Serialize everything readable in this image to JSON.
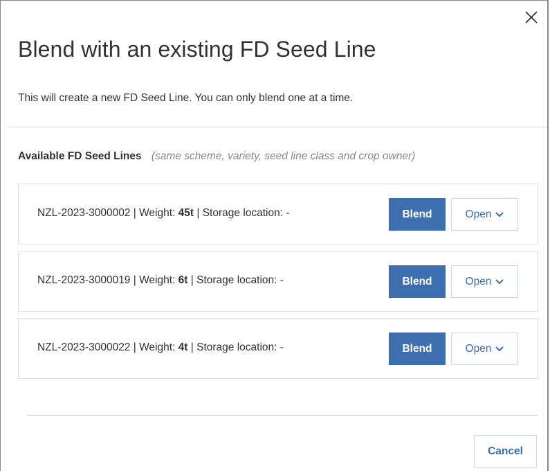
{
  "dialog": {
    "title": "Blend with an existing FD Seed Line",
    "subtitle": "This will create a new FD Seed Line. You can only blend one at a time.",
    "close_icon": "close-icon"
  },
  "section": {
    "label": "Available FD Seed Lines",
    "hint": "(same scheme, variety, seed line class and crop owner)"
  },
  "seed_lines": [
    {
      "id": "NZL-2023-3000002",
      "weight_label": "Weight:",
      "weight": "45t",
      "location_label": "Storage location:",
      "location": "-",
      "blend_label": "Blend",
      "open_label": "Open"
    },
    {
      "id": "NZL-2023-3000019",
      "weight_label": "Weight:",
      "weight": "6t",
      "location_label": "Storage location:",
      "location": "-",
      "blend_label": "Blend",
      "open_label": "Open"
    },
    {
      "id": "NZL-2023-3000022",
      "weight_label": "Weight:",
      "weight": "4t",
      "location_label": "Storage location:",
      "location": "-",
      "blend_label": "Blend",
      "open_label": "Open"
    }
  ],
  "footer": {
    "cancel_label": "Cancel"
  },
  "colors": {
    "primary": "#3d6fb0",
    "text": "#323130",
    "hint": "#8a8886",
    "border": "#e1dfdd"
  }
}
